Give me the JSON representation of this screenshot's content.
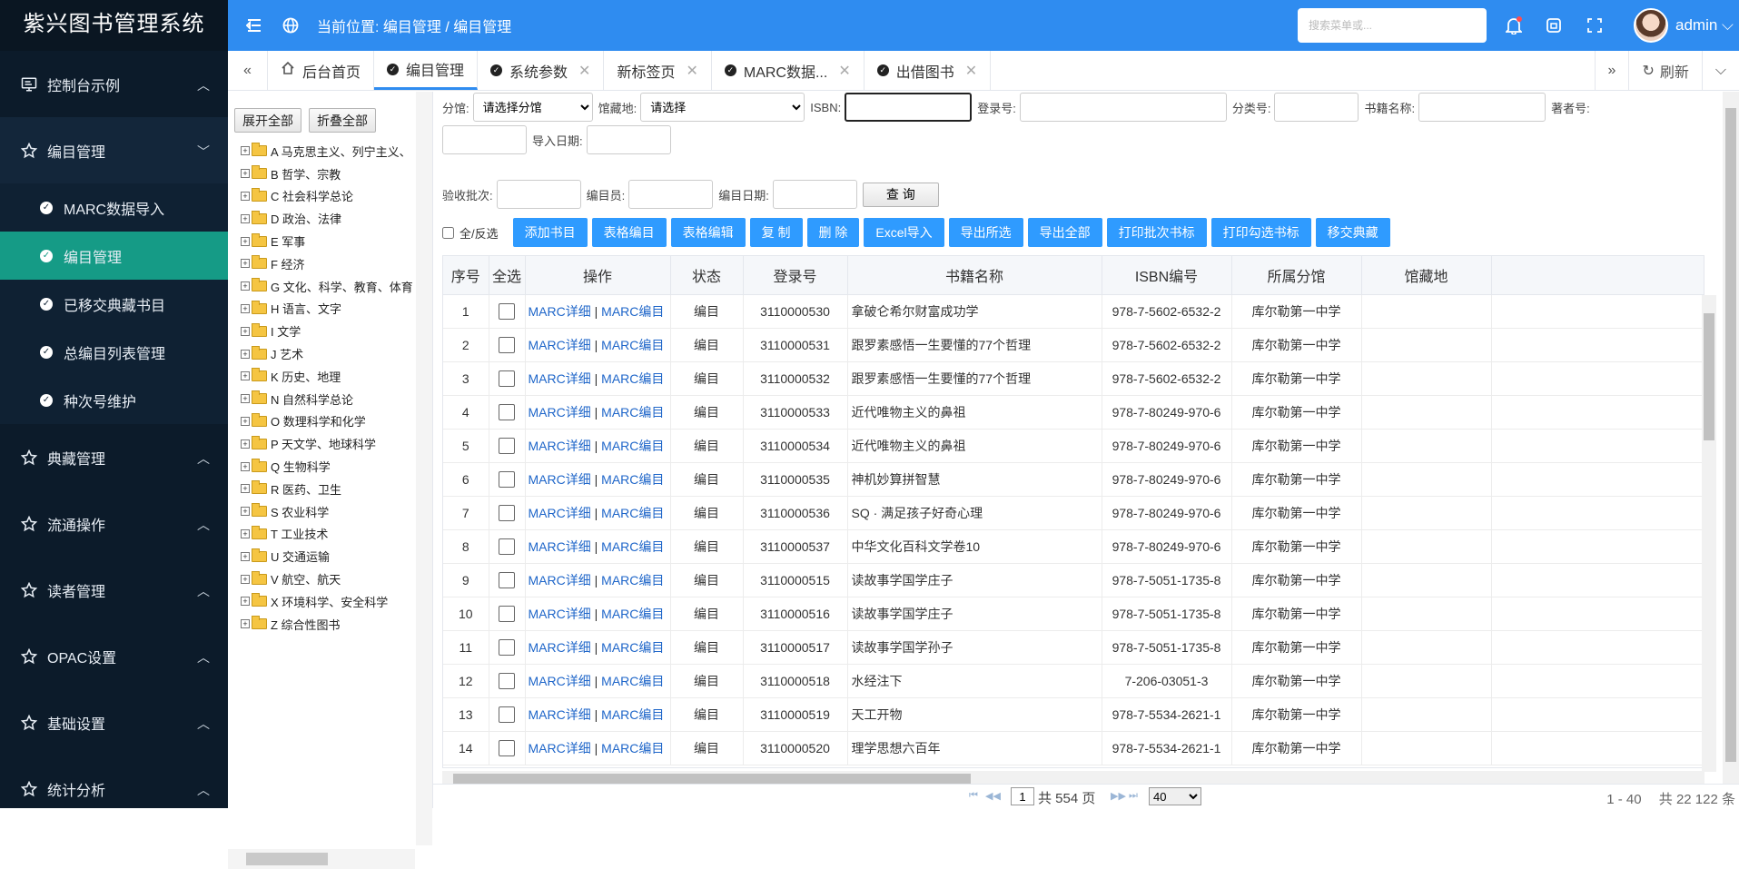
{
  "app": {
    "title": "紫兴图书管理系统",
    "user": "admin"
  },
  "header": {
    "breadcrumb": "当前位置: 编目管理 / 编目管理",
    "search_placeholder": "搜索菜单或..."
  },
  "sidebar": {
    "groups": [
      {
        "label": "控制台示例",
        "expanded": false
      },
      {
        "label": "编目管理",
        "expanded": true,
        "items": [
          {
            "label": "MARC数据导入",
            "active": false
          },
          {
            "label": "编目管理",
            "active": true
          },
          {
            "label": "已移交典藏书目",
            "active": false
          },
          {
            "label": "总编目列表管理",
            "active": false
          },
          {
            "label": "种次号维护",
            "active": false
          }
        ]
      },
      {
        "label": "典藏管理",
        "expanded": false
      },
      {
        "label": "流通操作",
        "expanded": false
      },
      {
        "label": "读者管理",
        "expanded": false
      },
      {
        "label": "OPAC设置",
        "expanded": false
      },
      {
        "label": "基础设置",
        "expanded": false
      },
      {
        "label": "统计分析",
        "expanded": false
      }
    ]
  },
  "tabs": {
    "items": [
      {
        "label": "后台首页",
        "icon": "home-icon",
        "closable": false,
        "active": false
      },
      {
        "label": "编目管理",
        "icon": "check-circle-icon",
        "closable": false,
        "active": true
      },
      {
        "label": "系统参数",
        "icon": "check-circle-icon",
        "closable": true,
        "active": false
      },
      {
        "label": "新标签页",
        "icon": "",
        "closable": true,
        "active": false
      },
      {
        "label": "MARC数据...",
        "icon": "check-circle-icon",
        "closable": true,
        "active": false
      },
      {
        "label": "出借图书",
        "icon": "check-circle-icon",
        "closable": true,
        "active": false
      }
    ],
    "refresh_label": "刷新"
  },
  "tree": {
    "expand_all": "展开全部",
    "collapse_all": "折叠全部",
    "nodes": [
      "A 马克思主义、列宁主义、",
      "B 哲学、宗教",
      "C 社会科学总论",
      "D 政治、法律",
      "E 军事",
      "F 经济",
      "G 文化、科学、教育、体育",
      "H 语言、文字",
      "I 文学",
      "J 艺术",
      "K 历史、地理",
      "N 自然科学总论",
      "O 数理科学和化学",
      "P 天文学、地球科学",
      "Q 生物科学",
      "R 医药、卫生",
      "S 农业科学",
      "T 工业技术",
      "U 交通运输",
      "V 航空、航天",
      "X 环境科学、安全科学",
      "Z 综合性图书"
    ]
  },
  "filters": {
    "branch_label": "分馆:",
    "branch_value": "请选择分馆",
    "location_label": "馆藏地:",
    "location_value": "请选择",
    "isbn_label": "ISBN:",
    "regno_label": "登录号:",
    "class_label": "分类号:",
    "title_label": "书籍名称:",
    "author_label": "著者号:",
    "import_date_label": "导入日期:",
    "batch_label": "验收批次:",
    "cataloger_label": "编目员:",
    "catalog_date_label": "编目日期:",
    "query_label": "查 询"
  },
  "actions": {
    "select_all_label": "全/反选",
    "buttons": [
      "添加书目",
      "表格编目",
      "表格编辑",
      "复 制",
      "删 除",
      "Excel导入",
      "导出所选",
      "导出全部",
      "打印批次书标",
      "打印勾选书标",
      "移交典藏"
    ]
  },
  "table": {
    "columns": [
      "序号",
      "全选",
      "操作",
      "状态",
      "登录号",
      "书籍名称",
      "ISBN编号",
      "所属分馆",
      "馆藏地"
    ],
    "op_detail": "MARC详细",
    "op_sep": " | ",
    "op_edit": "MARC编目",
    "rows": [
      {
        "no": "1",
        "status": "编目",
        "regno": "3110000530",
        "title": "拿破仑希尔财富成功学",
        "isbn": "978-7-5602-6532-2",
        "branch": "库尔勒第一中学",
        "location": ""
      },
      {
        "no": "2",
        "status": "编目",
        "regno": "3110000531",
        "title": "跟罗素感悟一生要懂的77个哲理",
        "isbn": "978-7-5602-6532-2",
        "branch": "库尔勒第一中学",
        "location": ""
      },
      {
        "no": "3",
        "status": "编目",
        "regno": "3110000532",
        "title": "跟罗素感悟一生要懂的77个哲理",
        "isbn": "978-7-5602-6532-2",
        "branch": "库尔勒第一中学",
        "location": ""
      },
      {
        "no": "4",
        "status": "编目",
        "regno": "3110000533",
        "title": "近代唯物主义的鼻祖",
        "isbn": "978-7-80249-970-6",
        "branch": "库尔勒第一中学",
        "location": ""
      },
      {
        "no": "5",
        "status": "编目",
        "regno": "3110000534",
        "title": "近代唯物主义的鼻祖",
        "isbn": "978-7-80249-970-6",
        "branch": "库尔勒第一中学",
        "location": ""
      },
      {
        "no": "6",
        "status": "编目",
        "regno": "3110000535",
        "title": "神机妙算拼智慧",
        "isbn": "978-7-80249-970-6",
        "branch": "库尔勒第一中学",
        "location": ""
      },
      {
        "no": "7",
        "status": "编目",
        "regno": "3110000536",
        "title": "SQ · 满足孩子好奇心理",
        "isbn": "978-7-80249-970-6",
        "branch": "库尔勒第一中学",
        "location": ""
      },
      {
        "no": "8",
        "status": "编目",
        "regno": "3110000537",
        "title": "中华文化百科文学卷10",
        "isbn": "978-7-80249-970-6",
        "branch": "库尔勒第一中学",
        "location": ""
      },
      {
        "no": "9",
        "status": "编目",
        "regno": "3110000515",
        "title": "读故事学国学庄子",
        "isbn": "978-7-5051-1735-8",
        "branch": "库尔勒第一中学",
        "location": ""
      },
      {
        "no": "10",
        "status": "编目",
        "regno": "3110000516",
        "title": "读故事学国学庄子",
        "isbn": "978-7-5051-1735-8",
        "branch": "库尔勒第一中学",
        "location": ""
      },
      {
        "no": "11",
        "status": "编目",
        "regno": "3110000517",
        "title": "读故事学国学孙子",
        "isbn": "978-7-5051-1735-8",
        "branch": "库尔勒第一中学",
        "location": ""
      },
      {
        "no": "12",
        "status": "编目",
        "regno": "3110000518",
        "title": "水经注下",
        "isbn": "7-206-03051-3",
        "branch": "库尔勒第一中学",
        "location": ""
      },
      {
        "no": "13",
        "status": "编目",
        "regno": "3110000519",
        "title": "天工开物",
        "isbn": "978-7-5534-2621-1",
        "branch": "库尔勒第一中学",
        "location": ""
      },
      {
        "no": "14",
        "status": "编目",
        "regno": "3110000520",
        "title": "理学思想六百年",
        "isbn": "978-7-5534-2621-1",
        "branch": "库尔勒第一中学",
        "location": ""
      }
    ]
  },
  "pager": {
    "page": "1",
    "total_pages_text": "共 554 页",
    "page_size": "40",
    "range_text": "1 - 40 　共 22 122 条"
  },
  "colors": {
    "header": "#2f8cf0",
    "sidebar": "#0c1b2a",
    "active_menu": "#159b86",
    "button": "#2f9bff",
    "link": "#1f66c9"
  }
}
